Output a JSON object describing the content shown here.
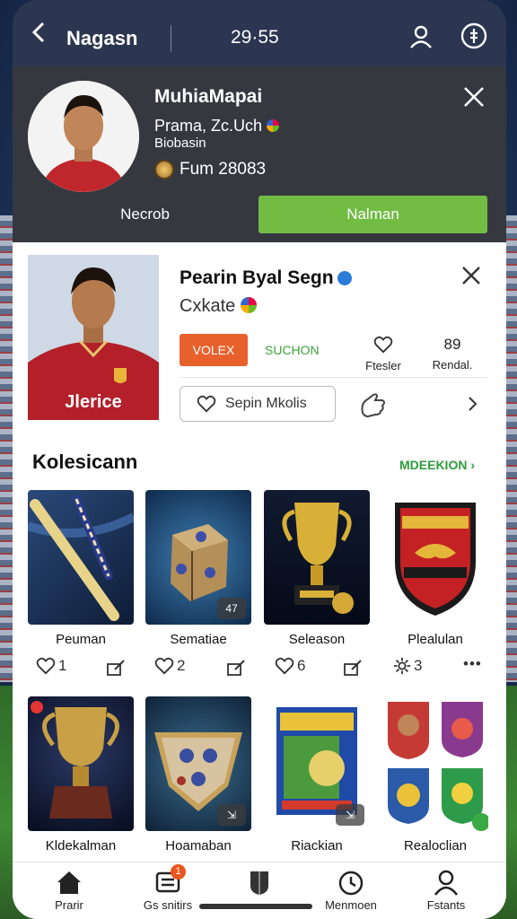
{
  "topbar": {
    "title": "Nagasn",
    "clock": "29·55"
  },
  "popup": {
    "name": "MuhiaMapai",
    "line1": "Prama, Zc.Uch",
    "line2": "Biobasin",
    "fum": "Fum 28083",
    "btn_left": "Necrob",
    "btn_right": "Nalman"
  },
  "card": {
    "name": "Pearin Byal Segn",
    "sub": "Cxkate",
    "tag_orange": "VOLEX",
    "tag_green": "SUCHON",
    "stat1_label": "Ftesler",
    "stat2_value": "89",
    "stat2_label": "Rendal.",
    "sepin_label": "Sepin Mkolis",
    "jersey_text": "Jlerice"
  },
  "collection": {
    "title": "Kolesicann",
    "more": "MDEEKION",
    "row1": [
      {
        "label": "Peuman",
        "actions": [
          "1",
          ""
        ]
      },
      {
        "label": "Sematiae",
        "badge": "47",
        "actions": [
          "2",
          ""
        ]
      },
      {
        "label": "Seleason",
        "actions": [
          "6",
          ""
        ]
      },
      {
        "label": "Plealulan",
        "actions": [
          "3",
          "•••"
        ]
      }
    ],
    "row2": [
      {
        "label": "Kldekalman"
      },
      {
        "label": "Hoamaban"
      },
      {
        "label": "Riackian"
      },
      {
        "label": "Realoclian"
      }
    ]
  },
  "nav": [
    {
      "label": "Prarir"
    },
    {
      "label": "Gs snitirs",
      "badge": "1"
    },
    {
      "label": ""
    },
    {
      "label": "Menmoen"
    },
    {
      "label": "Fstants"
    }
  ]
}
